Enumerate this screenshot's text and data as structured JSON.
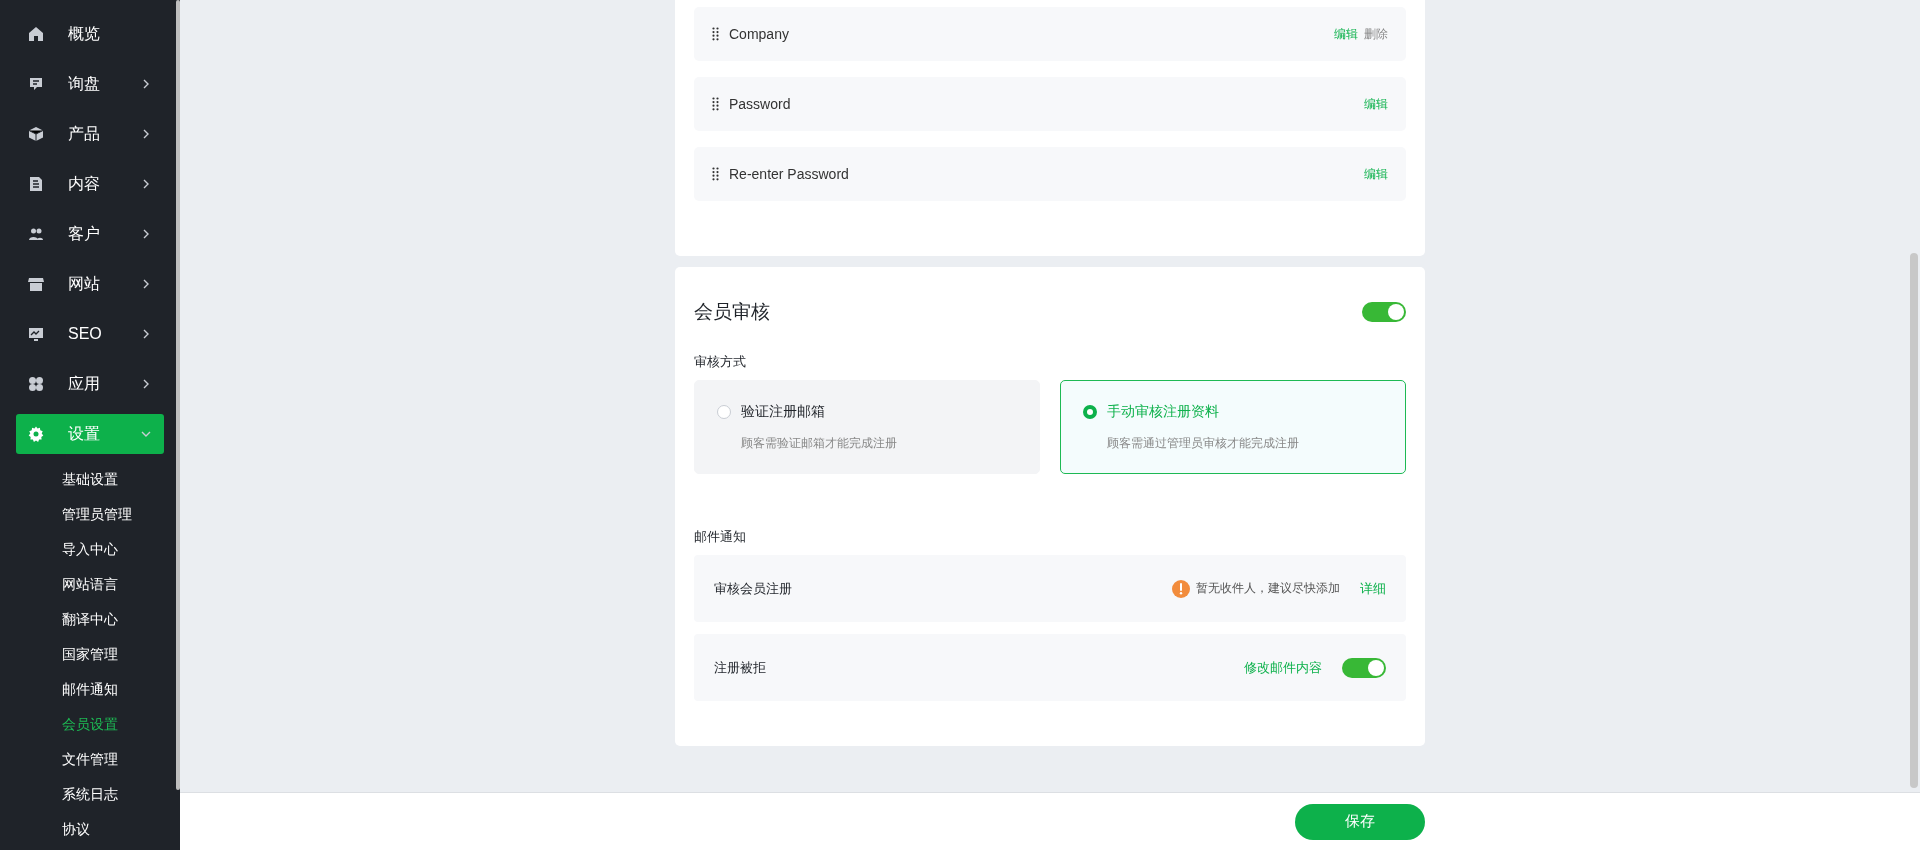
{
  "sidebar": {
    "items": [
      {
        "label": "概览",
        "has_children": false,
        "selected": false
      },
      {
        "label": "询盘",
        "has_children": true,
        "expanded": false,
        "selected": false
      },
      {
        "label": "产品",
        "has_children": true,
        "expanded": false,
        "selected": false
      },
      {
        "label": "内容",
        "has_children": true,
        "expanded": false,
        "selected": false
      },
      {
        "label": "客户",
        "has_children": true,
        "expanded": false,
        "selected": false
      },
      {
        "label": "网站",
        "has_children": true,
        "expanded": false,
        "selected": false
      },
      {
        "label": "SEO",
        "has_children": true,
        "expanded": false,
        "selected": false
      },
      {
        "label": "应用",
        "has_children": true,
        "expanded": false,
        "selected": false
      },
      {
        "label": "设置",
        "has_children": true,
        "expanded": true,
        "selected": true,
        "children": [
          {
            "label": "基础设置",
            "selected": false
          },
          {
            "label": "管理员管理",
            "selected": false
          },
          {
            "label": "导入中心",
            "selected": false
          },
          {
            "label": "网站语言",
            "selected": false
          },
          {
            "label": "翻译中心",
            "selected": false
          },
          {
            "label": "国家管理",
            "selected": false
          },
          {
            "label": "邮件通知",
            "selected": false
          },
          {
            "label": "会员设置",
            "selected": true
          },
          {
            "label": "文件管理",
            "selected": false
          },
          {
            "label": "系统日志",
            "selected": false
          },
          {
            "label": "协议",
            "selected": false
          }
        ]
      }
    ]
  },
  "fields": [
    {
      "label": "Company",
      "actions": [
        {
          "label": "编辑",
          "kind": "edit"
        },
        {
          "label": "删除",
          "kind": "delete"
        }
      ]
    },
    {
      "label": "Password",
      "actions": [
        {
          "label": "编辑",
          "kind": "edit"
        }
      ]
    },
    {
      "label": "Re-enter Password",
      "actions": [
        {
          "label": "编辑",
          "kind": "edit"
        }
      ]
    }
  ],
  "member_review": {
    "title": "会员审核",
    "on": true,
    "method_label": "审核方式",
    "options": [
      {
        "title": "验证注册邮箱",
        "description": "顾客需验证邮箱才能完成注册",
        "selected": false
      },
      {
        "title": "手动审核注册资料",
        "description": "顾客需通过管理员审核才能完成注册",
        "selected": true
      }
    ],
    "mail_label": "邮件通知",
    "mail_rows": [
      {
        "kind": "warning",
        "label": "审核会员注册",
        "warning": "暂无收件人，建议尽快添加",
        "link": "详细"
      },
      {
        "kind": "toggle",
        "label": "注册被拒",
        "link": "修改邮件内容",
        "on": true
      }
    ]
  },
  "save_button": "保存"
}
